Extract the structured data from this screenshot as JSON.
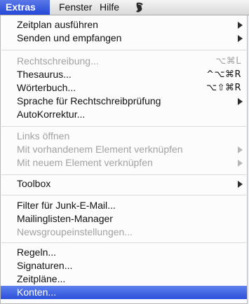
{
  "menubar": {
    "items": [
      {
        "label": "Extras"
      },
      {
        "label": "Fenster"
      },
      {
        "label": "Hilfe"
      }
    ],
    "script_icon": "applescript-scroll-icon"
  },
  "menu": {
    "groups": [
      {
        "items": [
          {
            "label": "Zeitplan ausführen",
            "submenu": true
          },
          {
            "label": "Senden und empfangen",
            "submenu": true
          }
        ]
      },
      {
        "items": [
          {
            "label": "Rechtschreibung...",
            "shortcut": "⌥⌘L",
            "disabled": true
          },
          {
            "label": "Thesaurus...",
            "shortcut": "^⌥⌘R"
          },
          {
            "label": "Wörterbuch...",
            "shortcut": "⌥⇧⌘R"
          },
          {
            "label": "Sprache für Rechtschreibprüfung",
            "submenu": true
          },
          {
            "label": "AutoKorrektur..."
          }
        ]
      },
      {
        "items": [
          {
            "label": "Links öffnen",
            "disabled": true
          },
          {
            "label": "Mit vorhandenem Element verknüpfen",
            "submenu": true,
            "disabled": true
          },
          {
            "label": "Mit neuem Element verknüpfen",
            "submenu": true,
            "disabled": true
          }
        ]
      },
      {
        "items": [
          {
            "label": "Toolbox",
            "submenu": true
          }
        ]
      },
      {
        "items": [
          {
            "label": "Filter für Junk-E-Mail..."
          },
          {
            "label": "Mailinglisten-Manager"
          },
          {
            "label": "Newsgroupeinstellungen...",
            "disabled": true
          }
        ]
      },
      {
        "items": [
          {
            "label": "Regeln..."
          },
          {
            "label": "Signaturen..."
          },
          {
            "label": "Zeitpläne..."
          },
          {
            "label": "Konten...",
            "selected": true
          }
        ]
      }
    ]
  },
  "colors": {
    "highlight": "#2f55dc",
    "disabled_text": "#a2a2a2"
  }
}
